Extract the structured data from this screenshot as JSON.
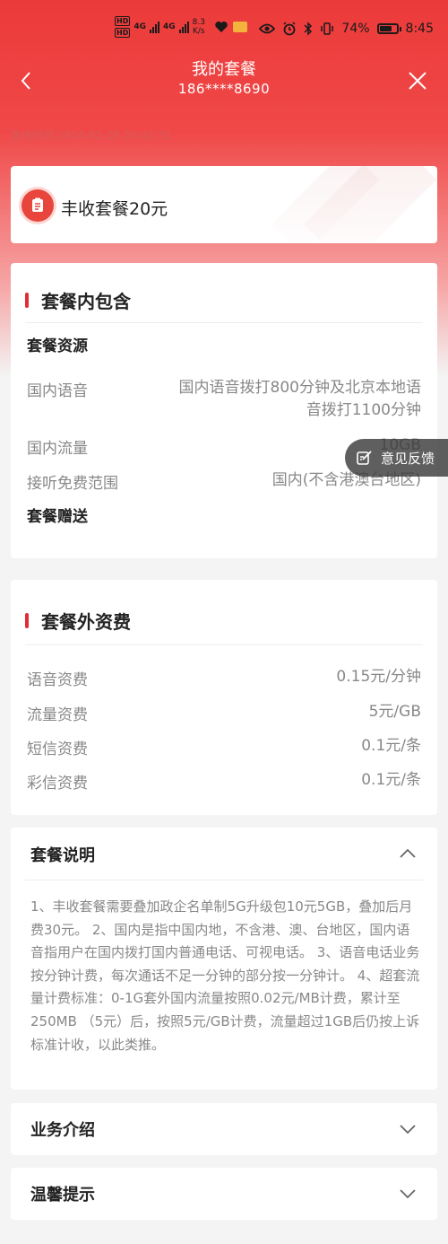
{
  "status_bar": {
    "hd1": "HD",
    "hd2": "HD",
    "net1": "4G",
    "net2": "4G",
    "speed_value": "8.3",
    "speed_unit": "K/s",
    "battery": "74%",
    "battery_level": 0.74,
    "time": "8:45",
    "icons": [
      "eye-icon",
      "alarm-icon",
      "bluetooth-icon",
      "vibrate-icon",
      "battery-icon",
      "leaf-icon"
    ]
  },
  "nav": {
    "title": "我的套餐",
    "phone": "186****8690",
    "back_icon": "chevron-left-icon",
    "close_icon": "close-icon"
  },
  "query_time": "查询时间 2024-02-28 20:43:32",
  "plan": {
    "name": "丰收套餐20元",
    "icon": "plan-document-icon"
  },
  "included": {
    "title": "套餐内包含",
    "resources_heading": "套餐资源",
    "rows": [
      {
        "label": "国内语音",
        "value_line1": "国内语音拨打800分钟及北京本地语",
        "value_line2": "音拨打1100分钟"
      },
      {
        "label": "国内流量",
        "value": "10GB"
      },
      {
        "label": "接听免费范围",
        "value": "国内(不含港澳台地区)"
      }
    ],
    "gift_heading": "套餐赠送"
  },
  "feedback": {
    "label": "意见反馈",
    "icon": "edit-icon"
  },
  "extra_fees": {
    "title": "套餐外资费",
    "rows": [
      {
        "label": "语音资费",
        "value": "0.15元/分钟"
      },
      {
        "label": "流量资费",
        "value": "5元/GB"
      },
      {
        "label": "短信资费",
        "value": "0.1元/条"
      },
      {
        "label": "彩信资费",
        "value": "0.1元/条"
      }
    ]
  },
  "description": {
    "title": "套餐说明",
    "text": "1、丰收套餐需要叠加政企名单制5G升级包10元5GB，叠加后月费30元。 2、国内是指中国内地，不含港、澳、台地区，国内语音指用户在国内拨打国内普通电话、可视电话。 3、语音电话业务按分钟计费，每次通话不足一分钟的部分按一分钟计。 4、超套流量计费标准：0-1G套外国内流量按照0.02元/MB计费，累计至250MB （5元）后，按照5元/GB计费，流量超过1GB后仍按上诉标准计收，以此类推。"
  },
  "business_intro": {
    "title": "业务介绍"
  },
  "tips": {
    "title": "温馨提示"
  },
  "colors": {
    "brand_red": "#e02e36",
    "header_gradient_top": "#ec3a3a"
  }
}
